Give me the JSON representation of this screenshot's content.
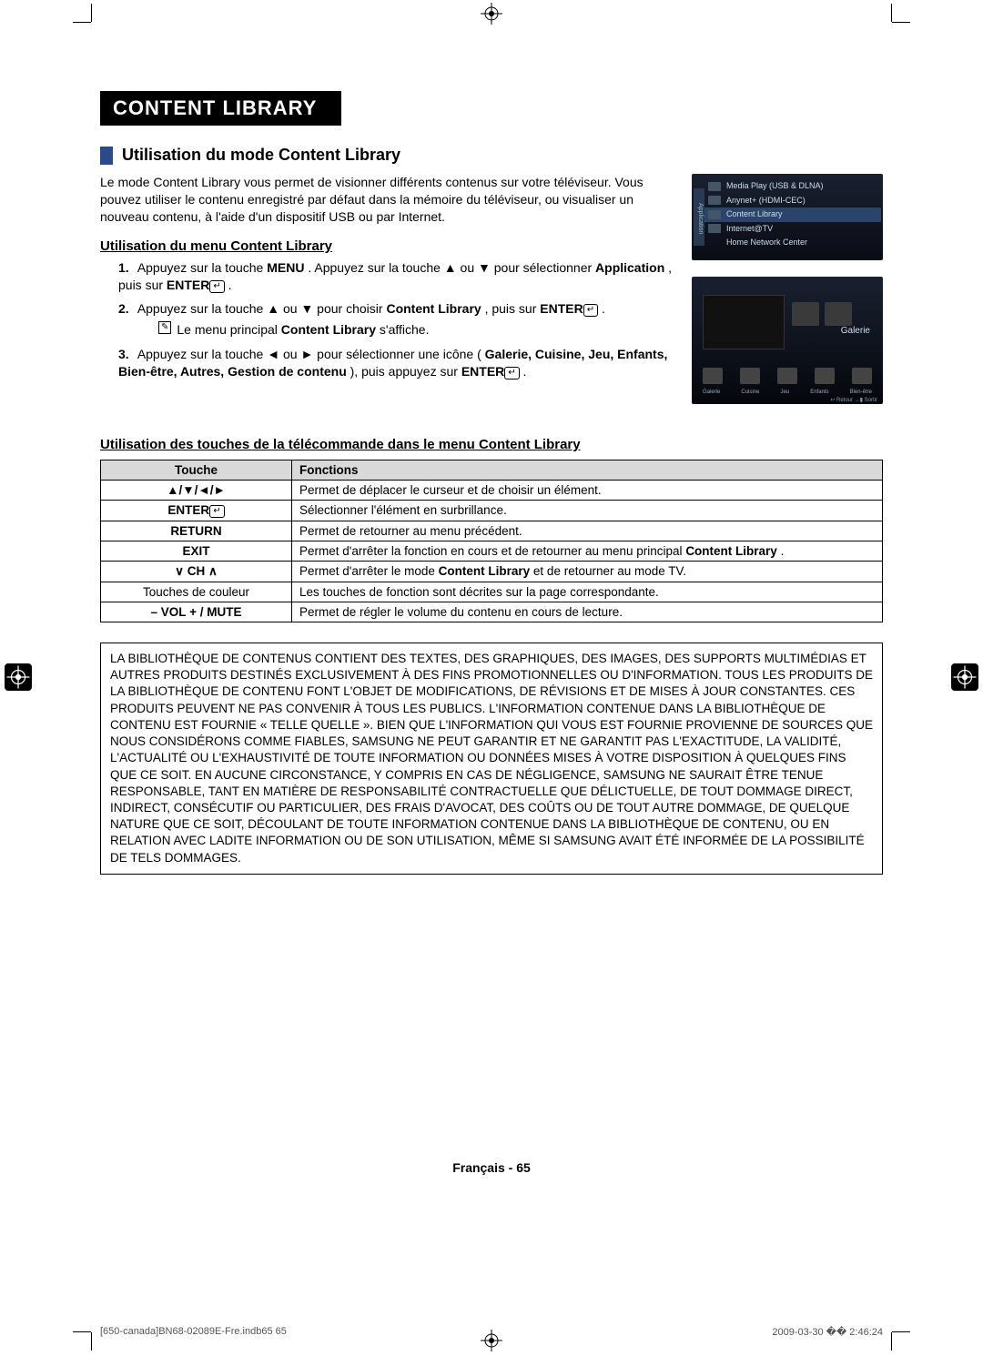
{
  "title": "CONTENT LIBRARY",
  "section_title": "Utilisation du mode Content Library",
  "intro_text": "Le mode Content Library vous permet de visionner différents contenus sur votre téléviseur. Vous pouvez utiliser le contenu enregistré par défaut dans la mémoire du téléviseur, ou visualiser un nouveau contenu, à l'aide d'un dispositif USB ou par Internet.",
  "subhead_menu": "Utilisation du menu Content Library",
  "steps": [
    {
      "num": "1.",
      "text_before": "Appuyez sur la touche ",
      "bold1": "MENU",
      "mid1": ". Appuyez sur la touche ▲ ou ▼ pour sélectionner ",
      "bold2": "Application",
      "mid2": ", puis sur ",
      "bold3": "ENTER",
      "tail": "."
    },
    {
      "num": "2.",
      "text_before": "Appuyez sur la touche ▲ ou ▼ pour choisir ",
      "bold1": "Content Library",
      "mid1": ", puis sur ",
      "bold2": "ENTER",
      "tail": ".",
      "note_pre": "Le menu principal ",
      "note_bold": "Content Library",
      "note_post": " s'affiche."
    },
    {
      "num": "3.",
      "text_before": "Appuyez sur la touche ◄ ou ► pour sélectionner une icône (",
      "bold1": "Galerie, Cuisine, Jeu, Enfants, Bien-être, Autres, Gestion de contenu",
      "mid1": "), puis appuyez sur ",
      "bold2": "ENTER",
      "tail": "."
    }
  ],
  "remote_head": "Utilisation des touches de la télécommande dans le menu Content Library",
  "table": {
    "headers": [
      "Touche",
      "Fonctions"
    ],
    "rows": [
      {
        "key": "▲/▼/◄/►",
        "fn": "Permet de déplacer le curseur et de choisir un élément."
      },
      {
        "key": "ENTER",
        "key_icon": true,
        "fn": "Sélectionner l'élément en surbrillance."
      },
      {
        "key": "RETURN",
        "fn": "Permet de retourner au menu précédent."
      },
      {
        "key": "EXIT",
        "fn_pre": "Permet d'arrêter la fonction en cours et de retourner au menu principal ",
        "fn_bold": "Content Library",
        "fn_post": "."
      },
      {
        "key": "∨ CH ∧",
        "fn_pre": "Permet d'arrêter le mode ",
        "fn_bold": "Content Library",
        "fn_post": " et de retourner au mode TV."
      },
      {
        "key_plain": "Touches de couleur",
        "fn": "Les touches de fonction sont décrites sur la page correspondante."
      },
      {
        "key": "– VOL + / MUTE",
        "fn": "Permet de régler le volume du contenu en cours de lecture."
      }
    ]
  },
  "disclaimer": "LA BIBLIOTHÈQUE DE CONTENUS CONTIENT DES TEXTES, DES GRAPHIQUES, DES IMAGES, DES SUPPORTS MULTIMÉDIAS ET AUTRES PRODUITS DESTINÉS EXCLUSIVEMENT À DES FINS PROMOTIONNELLES OU D'INFORMATION. TOUS LES PRODUITS DE LA BIBLIOTHÈQUE DE CONTENU FONT L'OBJET DE MODIFICATIONS, DE RÉVISIONS ET DE MISES À JOUR CONSTANTES. CES PRODUITS PEUVENT NE PAS CONVENIR À TOUS LES PUBLICS. L'INFORMATION CONTENUE DANS LA BIBLIOTHÈQUE DE CONTENU EST FOURNIE « TELLE QUELLE ». BIEN QUE L'INFORMATION QUI VOUS EST FOURNIE PROVIENNE DE SOURCES QUE NOUS CONSIDÉRONS COMME FIABLES, SAMSUNG NE PEUT GARANTIR ET NE GARANTIT PAS L'EXACTITUDE, LA VALIDITÉ, L'ACTUALITÉ OU L'EXHAUSTIVITÉ DE TOUTE INFORMATION OU DONNÉES MISES À VOTRE DISPOSITION À QUELQUES FINS QUE CE SOIT. EN AUCUNE CIRCONSTANCE, Y COMPRIS EN CAS DE NÉGLIGENCE, SAMSUNG NE SAURAIT ÊTRE TENUE RESPONSABLE, TANT EN MATIÈRE DE RESPONSABILITÉ CONTRACTUELLE QUE DÉLICTUELLE, DE TOUT DOMMAGE DIRECT, INDIRECT, CONSÉCUTIF OU PARTICULIER, DES FRAIS D'AVOCAT, DES COÛTS OU DE TOUT AUTRE DOMMAGE, DE QUELQUE NATURE QUE CE SOIT, DÉCOULANT DE TOUTE INFORMATION CONTENUE DANS LA BIBLIOTHÈQUE DE CONTENU, OU EN RELATION AVEC LADITE INFORMATION OU DE SON UTILISATION, MÊME SI SAMSUNG AVAIT ÉTÉ INFORMÉE DE LA POSSIBILITÉ DE TELS DOMMAGES.",
  "page_label": "Français - 65",
  "screenshot1": {
    "side": "Application",
    "rows": [
      "Media Play (USB & DLNA)",
      "Anynet+ (HDMI-CEC)",
      "Content Library",
      "Internet@TV",
      "Home Network Center"
    ]
  },
  "screenshot2": {
    "label": "Galerie",
    "captions": [
      "Galerie",
      "Cuisine",
      "Jeu",
      "Enfants",
      "Bien-être"
    ],
    "footer": "↩ Retour   →▮ Sortir"
  },
  "footer": {
    "file": "[650-canada]BN68-02089E-Fre.indb65   65",
    "date": "2009-03-30   �� 2:46:24"
  }
}
